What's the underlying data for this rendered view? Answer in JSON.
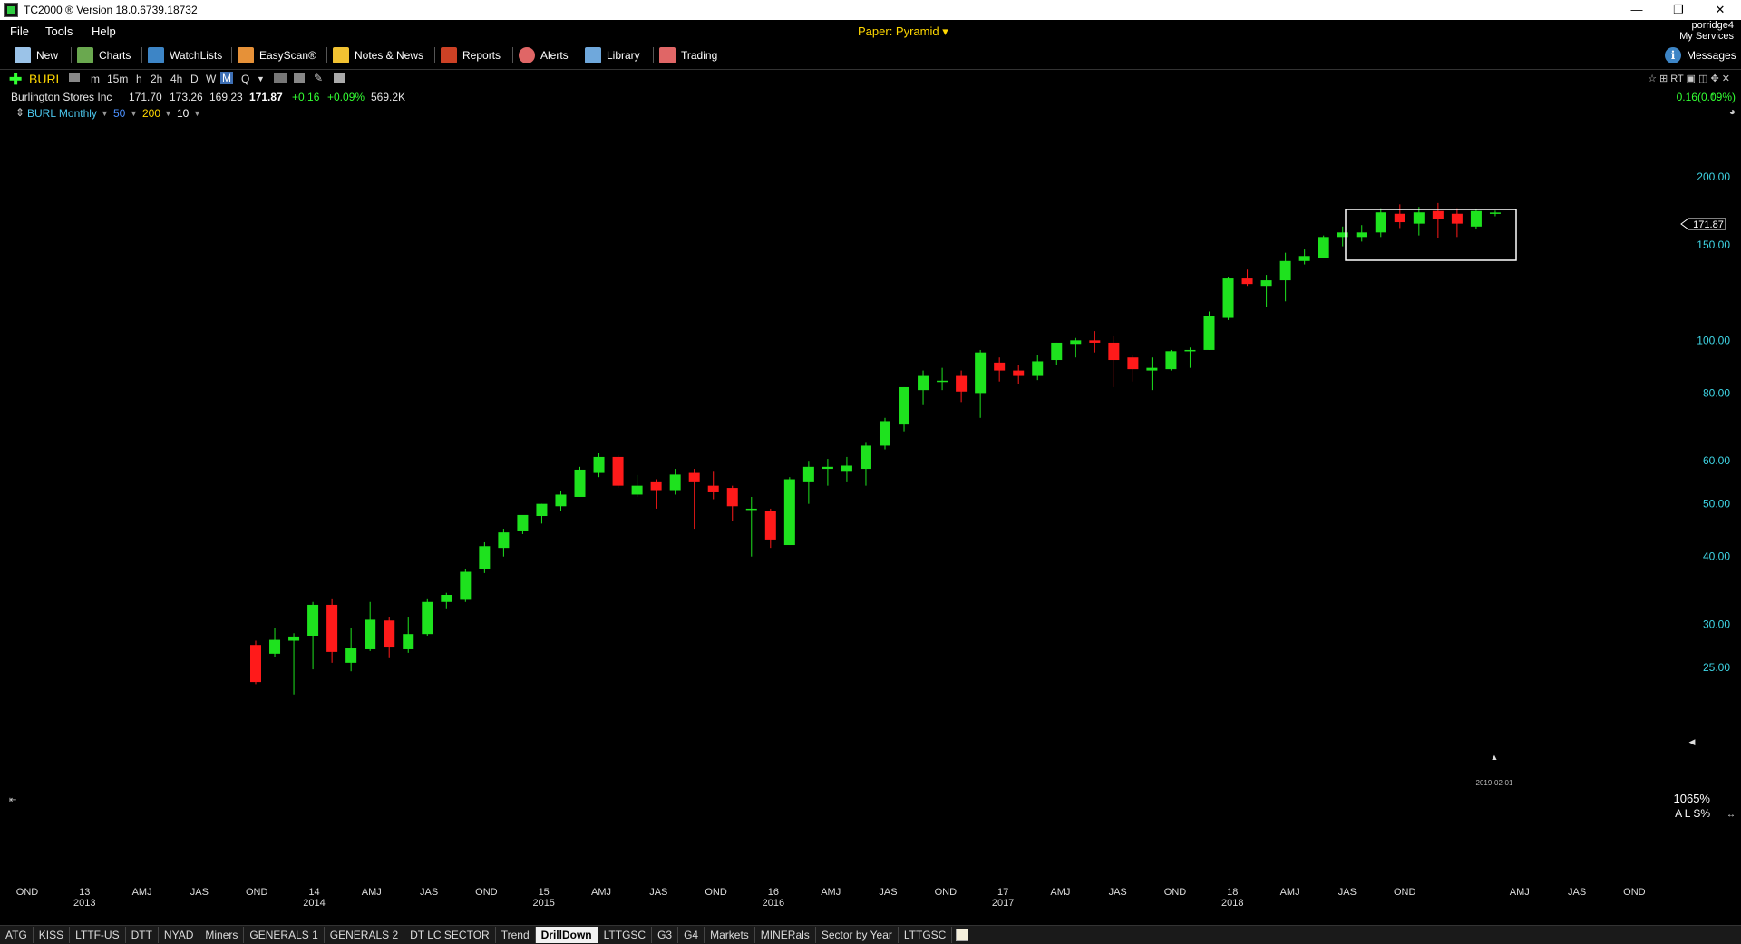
{
  "window": {
    "title": "TC2000 ® Version 18.0.6739.18732",
    "controls": [
      "—",
      "❐",
      "✕"
    ]
  },
  "menu": {
    "items": [
      "File",
      "Tools",
      "Help"
    ],
    "paper_account": "Paper: Pyramid ▾",
    "user_name": "porridge4",
    "services_link": "My Services"
  },
  "toolbar": {
    "new": "New",
    "charts": "Charts",
    "watchlists": "WatchLists",
    "easyscan": "EasyScan®",
    "notes": "Notes & News",
    "reports": "Reports",
    "alerts": "Alerts",
    "library": "Library",
    "trading": "Trading",
    "messages": "Messages",
    "colors": {
      "new": "#9bc3e8",
      "charts": "#6aa84f",
      "watchlists": "#3d85c6",
      "easyscan": "#e69138",
      "notes": "#f1c232",
      "reports": "#cc4125",
      "alerts": "#e06666",
      "library": "#6fa8dc",
      "trading": "#e06666",
      "messages": "#3d85c6"
    }
  },
  "symbol": {
    "ticker": "BURL",
    "timeframes": [
      "m",
      "15m",
      "h",
      "2h",
      "4h",
      "D",
      "W",
      "M",
      "Q"
    ],
    "active_timeframe": "M",
    "right_tools": "☆ ⊞ RT  ▣ ◫ ✥ ✕"
  },
  "quote": {
    "name": "Burlington Stores Inc",
    "open": "171.70",
    "high": "173.26",
    "low": "169.23",
    "last": "171.87",
    "change": "+0.16",
    "change_pct": "+0.09%",
    "volume": "569.2K",
    "net_change_right": "0.16(0.09%)"
  },
  "indicators": {
    "chart_label": "BURL Monthly",
    "ma1": "50",
    "ma2": "200",
    "ma3": "10"
  },
  "chart_data": {
    "type": "candlestick",
    "title": "BURL Monthly",
    "y_scale": "log",
    "y_ticks": [
      25,
      30,
      40,
      50,
      60,
      80,
      100,
      150,
      200
    ],
    "y_tick_labels": [
      "25.00",
      "30.00",
      "40.00",
      "50.00",
      "60.00",
      "80.00",
      "100.00",
      "150.00",
      "200.00"
    ],
    "x_labels": [
      {
        "q": "OND",
        "yr": ""
      },
      {
        "q": "13",
        "yr": "2013"
      },
      {
        "q": "AMJ",
        "yr": ""
      },
      {
        "q": "JAS",
        "yr": ""
      },
      {
        "q": "OND",
        "yr": ""
      },
      {
        "q": "14",
        "yr": "2014"
      },
      {
        "q": "AMJ",
        "yr": ""
      },
      {
        "q": "JAS",
        "yr": ""
      },
      {
        "q": "OND",
        "yr": ""
      },
      {
        "q": "15",
        "yr": "2015"
      },
      {
        "q": "AMJ",
        "yr": ""
      },
      {
        "q": "JAS",
        "yr": ""
      },
      {
        "q": "OND",
        "yr": ""
      },
      {
        "q": "16",
        "yr": "2016"
      },
      {
        "q": "AMJ",
        "yr": ""
      },
      {
        "q": "JAS",
        "yr": ""
      },
      {
        "q": "OND",
        "yr": ""
      },
      {
        "q": "17",
        "yr": "2017"
      },
      {
        "q": "AMJ",
        "yr": ""
      },
      {
        "q": "JAS",
        "yr": ""
      },
      {
        "q": "OND",
        "yr": ""
      },
      {
        "q": "18",
        "yr": "2018"
      },
      {
        "q": "AMJ",
        "yr": ""
      },
      {
        "q": "JAS",
        "yr": ""
      },
      {
        "q": "OND",
        "yr": ""
      },
      {
        "q": "",
        "yr": ""
      },
      {
        "q": "AMJ",
        "yr": ""
      },
      {
        "q": "JAS",
        "yr": ""
      },
      {
        "q": "OND",
        "yr": ""
      }
    ],
    "date_marker": "2019-02-01",
    "last_price_label": "171.87",
    "zoom_label": "1065%",
    "scale_label": "A L S%",
    "candles": [
      {
        "o": 27.5,
        "h": 28.0,
        "l": 23.3,
        "c": 23.5
      },
      {
        "o": 26.5,
        "h": 29.6,
        "l": 26.1,
        "c": 28.1
      },
      {
        "o": 28.0,
        "h": 28.9,
        "l": 22.3,
        "c": 28.5
      },
      {
        "o": 28.6,
        "h": 33.0,
        "l": 24.8,
        "c": 32.6
      },
      {
        "o": 32.6,
        "h": 33.5,
        "l": 25.5,
        "c": 26.7
      },
      {
        "o": 25.5,
        "h": 29.5,
        "l": 24.6,
        "c": 27.1
      },
      {
        "o": 27.0,
        "h": 33.0,
        "l": 26.8,
        "c": 30.6
      },
      {
        "o": 30.5,
        "h": 31.0,
        "l": 26.0,
        "c": 27.2
      },
      {
        "o": 27.0,
        "h": 31.0,
        "l": 26.6,
        "c": 28.8
      },
      {
        "o": 28.8,
        "h": 33.5,
        "l": 28.6,
        "c": 33.0
      },
      {
        "o": 33.0,
        "h": 34.3,
        "l": 32.0,
        "c": 34.0
      },
      {
        "o": 33.3,
        "h": 38.0,
        "l": 33.0,
        "c": 37.5
      },
      {
        "o": 38.0,
        "h": 42.5,
        "l": 37.3,
        "c": 41.8
      },
      {
        "o": 41.5,
        "h": 45.0,
        "l": 40.0,
        "c": 44.3
      },
      {
        "o": 44.5,
        "h": 46.0,
        "l": 44.0,
        "c": 47.7
      },
      {
        "o": 47.5,
        "h": 50.0,
        "l": 46.0,
        "c": 50.0
      },
      {
        "o": 49.5,
        "h": 52.8,
        "l": 48.5,
        "c": 52.0
      },
      {
        "o": 51.5,
        "h": 58.5,
        "l": 51.5,
        "c": 57.8
      },
      {
        "o": 57.0,
        "h": 62.0,
        "l": 56.0,
        "c": 61.0
      },
      {
        "o": 61.0,
        "h": 61.5,
        "l": 53.5,
        "c": 54.0
      },
      {
        "o": 52.0,
        "h": 56.5,
        "l": 51.5,
        "c": 54.0
      },
      {
        "o": 55.0,
        "h": 55.5,
        "l": 49.0,
        "c": 53.0
      },
      {
        "o": 53.0,
        "h": 58.0,
        "l": 52.0,
        "c": 56.6
      },
      {
        "o": 57.0,
        "h": 58.0,
        "l": 45.0,
        "c": 55.0
      },
      {
        "o": 54.0,
        "h": 57.5,
        "l": 51.0,
        "c": 52.5
      },
      {
        "o": 53.5,
        "h": 54.0,
        "l": 46.5,
        "c": 49.5
      },
      {
        "o": 49.0,
        "h": 51.5,
        "l": 40.0,
        "c": 49.0
      },
      {
        "o": 48.5,
        "h": 49.0,
        "l": 41.5,
        "c": 43.0
      },
      {
        "o": 42.0,
        "h": 56.0,
        "l": 42.0,
        "c": 55.5
      },
      {
        "o": 55.0,
        "h": 60.0,
        "l": 50.0,
        "c": 58.5
      },
      {
        "o": 58.0,
        "h": 60.5,
        "l": 54.0,
        "c": 58.5
      },
      {
        "o": 57.5,
        "h": 61.0,
        "l": 55.0,
        "c": 58.8
      },
      {
        "o": 58.0,
        "h": 65.0,
        "l": 54.0,
        "c": 64.0
      },
      {
        "o": 64.0,
        "h": 72.0,
        "l": 63.0,
        "c": 71.0
      },
      {
        "o": 70.0,
        "h": 82.0,
        "l": 68.0,
        "c": 82.0
      },
      {
        "o": 81.0,
        "h": 88.0,
        "l": 76.0,
        "c": 86.0
      },
      {
        "o": 84.0,
        "h": 89.0,
        "l": 81.0,
        "c": 84.3
      },
      {
        "o": 86.0,
        "h": 88.0,
        "l": 77.0,
        "c": 80.5
      },
      {
        "o": 80.0,
        "h": 96.0,
        "l": 72.0,
        "c": 95.0
      },
      {
        "o": 91.0,
        "h": 93.0,
        "l": 84.0,
        "c": 88.0
      },
      {
        "o": 88.0,
        "h": 90.0,
        "l": 83.0,
        "c": 86.0
      },
      {
        "o": 86.0,
        "h": 94.0,
        "l": 84.5,
        "c": 91.5
      },
      {
        "o": 92.0,
        "h": 99.0,
        "l": 90.0,
        "c": 99.0
      },
      {
        "o": 98.5,
        "h": 101.0,
        "l": 93.0,
        "c": 100.0
      },
      {
        "o": 100.0,
        "h": 104.0,
        "l": 95.0,
        "c": 99.0
      },
      {
        "o": 99.0,
        "h": 102.0,
        "l": 82.0,
        "c": 92.0
      },
      {
        "o": 93.0,
        "h": 94.0,
        "l": 84.0,
        "c": 88.5
      },
      {
        "o": 88.0,
        "h": 93.0,
        "l": 81.0,
        "c": 89.0
      },
      {
        "o": 88.5,
        "h": 96.0,
        "l": 88.0,
        "c": 95.5
      },
      {
        "o": 95.5,
        "h": 97.0,
        "l": 89.0,
        "c": 96.0
      },
      {
        "o": 96.0,
        "h": 113.0,
        "l": 96.0,
        "c": 111.0
      },
      {
        "o": 110.0,
        "h": 131.0,
        "l": 109.0,
        "c": 130.0
      },
      {
        "o": 130.0,
        "h": 135.0,
        "l": 126.0,
        "c": 127.0
      },
      {
        "o": 126.0,
        "h": 132.0,
        "l": 115.0,
        "c": 129.0
      },
      {
        "o": 129.0,
        "h": 145.0,
        "l": 118.0,
        "c": 140.0
      },
      {
        "o": 140.0,
        "h": 147.0,
        "l": 138.0,
        "c": 143.0
      },
      {
        "o": 142.0,
        "h": 156.0,
        "l": 141.5,
        "c": 155.0
      },
      {
        "o": 155.0,
        "h": 162.0,
        "l": 149.0,
        "c": 158.0
      },
      {
        "o": 155.0,
        "h": 163.0,
        "l": 152.0,
        "c": 158.0
      },
      {
        "o": 158.0,
        "h": 175.0,
        "l": 155.0,
        "c": 172.0
      },
      {
        "o": 171.0,
        "h": 178.0,
        "l": 161.0,
        "c": 165.0
      },
      {
        "o": 164.0,
        "h": 176.0,
        "l": 156.0,
        "c": 172.0
      },
      {
        "o": 173.0,
        "h": 179.0,
        "l": 154.0,
        "c": 167.0
      },
      {
        "o": 171.0,
        "h": 175.0,
        "l": 155.0,
        "c": 164.0
      },
      {
        "o": 162.0,
        "h": 174.0,
        "l": 160.0,
        "c": 173.0
      },
      {
        "o": 171.7,
        "h": 173.3,
        "l": 169.2,
        "c": 171.9
      }
    ]
  },
  "tabs": {
    "items": [
      "ATG",
      "KISS",
      "LTTF-US",
      "DTT",
      "NYAD",
      "Miners",
      "GENERALS 1",
      "GENERALS 2",
      "DT LC SECTOR",
      "Trend",
      "DrillDown",
      "LTTGSC",
      "G3",
      "G4",
      "Markets",
      "MINERals",
      "Sector by Year",
      "LTTGSC"
    ],
    "active": "DrillDown"
  }
}
